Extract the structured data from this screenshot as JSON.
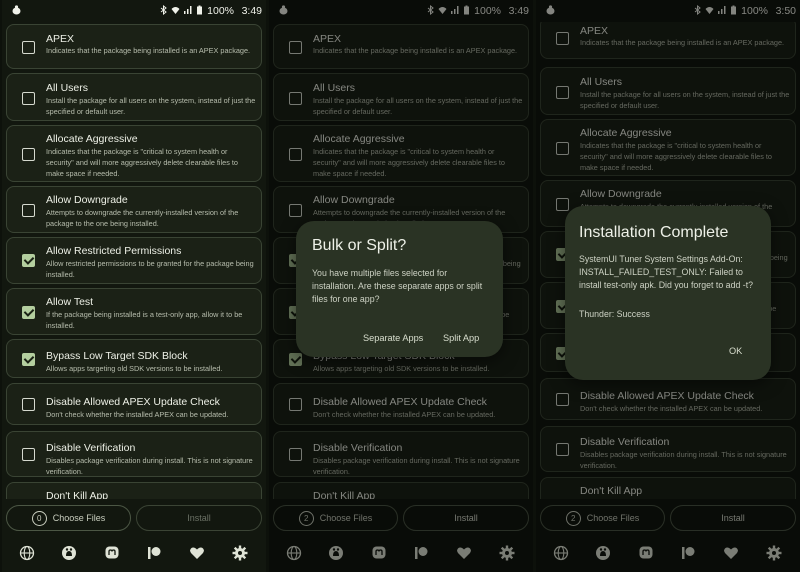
{
  "status_bar": {
    "battery": "100%",
    "times": [
      "3:49",
      "3:49",
      "3:50"
    ]
  },
  "options": [
    {
      "title": "APEX",
      "desc": "Indicates that the package being installed is an APEX package."
    },
    {
      "title": "All Users",
      "desc": "Install the package for all users on the system, instead of just the specified or default user."
    },
    {
      "title": "Allocate Aggressive",
      "desc": "Indicates that the package is \"critical to system health or security\" and will more aggressively delete clearable files to make space if needed."
    },
    {
      "title": "Allow Downgrade",
      "desc": "Attempts to downgrade the currently-installed version of the package to the one being installed."
    },
    {
      "title": "Allow Restricted Permissions",
      "desc": "Allow restricted permissions to be granted for the package being installed."
    },
    {
      "title": "Allow Test",
      "desc": "If the package being installed is a test-only app, allow it to be installed."
    },
    {
      "title": "Bypass Low Target SDK Block",
      "desc": "Allows apps targeting old SDK versions to be installed."
    },
    {
      "title": "Disable Allowed APEX Update Check",
      "desc": "Don't check whether the installed APEX can be updated."
    },
    {
      "title": "Disable Verification",
      "desc": "Disables package verification during install. This is not signature verification."
    },
    {
      "title": "Don't Kill App",
      "desc": ""
    }
  ],
  "checked": {
    "screen1": [
      false,
      false,
      false,
      false,
      true,
      true,
      true,
      false,
      false
    ],
    "screen2": [
      false,
      false,
      false,
      false,
      true,
      true,
      true,
      false,
      false
    ],
    "screen3": [
      false,
      false,
      false,
      false,
      true,
      true,
      true,
      false,
      false
    ]
  },
  "bottom": {
    "choose_label": "Choose Files",
    "install_label": "Install",
    "counts": [
      "0",
      "2",
      "2"
    ]
  },
  "nav_icons": [
    "globe-icon",
    "github-icon",
    "mastodon-icon",
    "patreon-icon",
    "heart-icon",
    "settings-icon"
  ],
  "dialog_split": {
    "title": "Bulk or Split?",
    "body": "You have multiple files selected for installation. Are these separate apps or split files for one app?",
    "separate_label": "Separate Apps",
    "split_label": "Split App"
  },
  "dialog_complete": {
    "title": "Installation Complete",
    "body": "SystemUI Tuner System Settings Add-On: INSTALL_FAILED_TEST_ONLY: Failed to install test-only apk. Did you forget to add -t?",
    "result": "Thunder: Success",
    "ok_label": "OK"
  },
  "colors": {
    "background": "#12170f",
    "card": "#1b2116",
    "card_border": "#3a4434",
    "checkbox_checked": "#b4cf9f",
    "dialog": "#2a3324"
  }
}
